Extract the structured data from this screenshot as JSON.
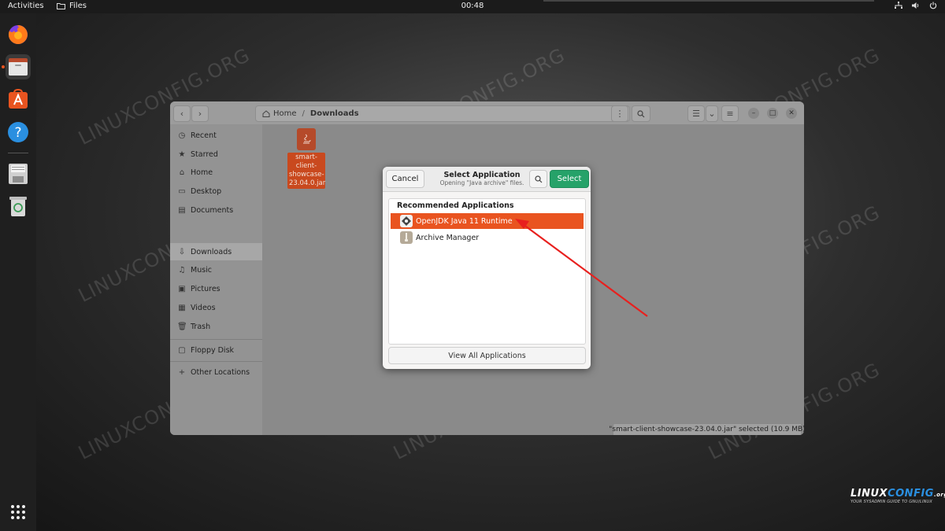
{
  "topbar": {
    "activities": "Activities",
    "app_name": "Files",
    "clock": "00:48"
  },
  "files": {
    "path": {
      "home": "Home",
      "current": "Downloads"
    },
    "sidebar": [
      {
        "icon": "clock-icon",
        "label": "Recent"
      },
      {
        "icon": "star-icon",
        "label": "Starred"
      },
      {
        "icon": "home-icon",
        "label": "Home"
      },
      {
        "icon": "desktop-icon",
        "label": "Desktop"
      },
      {
        "icon": "documents-icon",
        "label": "Documents"
      },
      {
        "icon": "downloads-icon",
        "label": "Downloads",
        "selected": true
      },
      {
        "icon": "music-icon",
        "label": "Music"
      },
      {
        "icon": "pictures-icon",
        "label": "Pictures"
      },
      {
        "icon": "videos-icon",
        "label": "Videos"
      },
      {
        "icon": "trash-icon",
        "label": "Trash"
      },
      {
        "icon": "floppy-icon",
        "label": "Floppy Disk"
      },
      {
        "icon": "plus-icon",
        "label": "Other Locations"
      }
    ],
    "file": {
      "name": "smart-client-showcase-23.04.0.jar",
      "lines": [
        "smart-",
        "client-",
        "showcase-",
        "23.04.0.jar"
      ]
    },
    "status": "\"smart-client-showcase-23.04.0.jar\" selected (10.9 MB)"
  },
  "dialog": {
    "cancel": "Cancel",
    "title": "Select Application",
    "subtitle": "Opening \"Java archive\" files.",
    "select": "Select",
    "list_header": "Recommended Applications",
    "apps": [
      {
        "label": "OpenJDK Java 11 Runtime",
        "selected": true
      },
      {
        "label": "Archive Manager",
        "selected": false
      }
    ],
    "view_all": "View All Applications"
  },
  "watermark": "LINUXCONFIG.ORG",
  "logo": {
    "brand_a": "LINUX",
    "brand_b": "CONFIG",
    "brand_c": ".org",
    "tagline": "YOUR SYSADMIN GUIDE TO GNU/LINUX"
  },
  "colors": {
    "accent": "#e95420",
    "select_green": "#26a269",
    "arrow": "#e8201e"
  }
}
